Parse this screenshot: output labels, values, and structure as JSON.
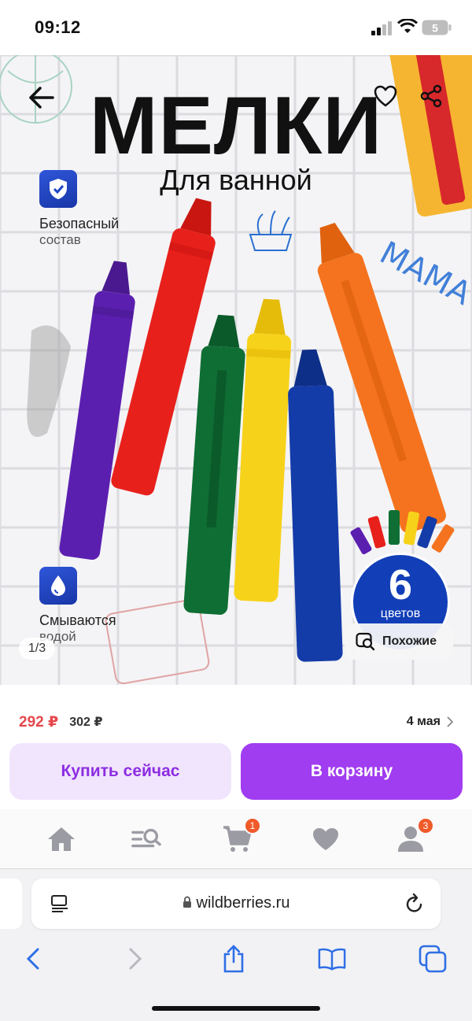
{
  "status_bar": {
    "time": "09:12",
    "battery": "5"
  },
  "hero": {
    "title": "МЕЛКИ",
    "subtitle": "Для ванной",
    "features": [
      {
        "line1": "Безопасный",
        "line2": "состав",
        "icon": "shield-check-icon"
      },
      {
        "line1": "Смываются",
        "line2": "водой",
        "icon": "water-drop-icon"
      }
    ],
    "wall_text": "МАМА",
    "counter": "1/3",
    "badge": {
      "number": "6",
      "label": "цветов"
    },
    "similar_label": "Похожие",
    "crayon_colors": [
      "#5b1fb0",
      "#e8201b",
      "#0f6e34",
      "#f7d21a",
      "#133ca8",
      "#f5731e"
    ]
  },
  "price": {
    "current": "292 ₽",
    "old": "302 ₽",
    "delivery": "4 мая"
  },
  "buttons": {
    "buy_now": "Купить сейчас",
    "to_cart": "В корзину"
  },
  "tabs": [
    {
      "name": "home",
      "icon": "home-icon"
    },
    {
      "name": "catalog",
      "icon": "catalog-search-icon"
    },
    {
      "name": "cart",
      "icon": "cart-icon",
      "count": "1"
    },
    {
      "name": "favorites",
      "icon": "heart-icon"
    },
    {
      "name": "profile",
      "icon": "profile-icon",
      "count": "3"
    }
  ],
  "browser": {
    "url": "wildberries.ru"
  },
  "colors": {
    "accent": "#a03df0",
    "price_red": "#e5484d",
    "badge_orange": "#f05a2a"
  }
}
